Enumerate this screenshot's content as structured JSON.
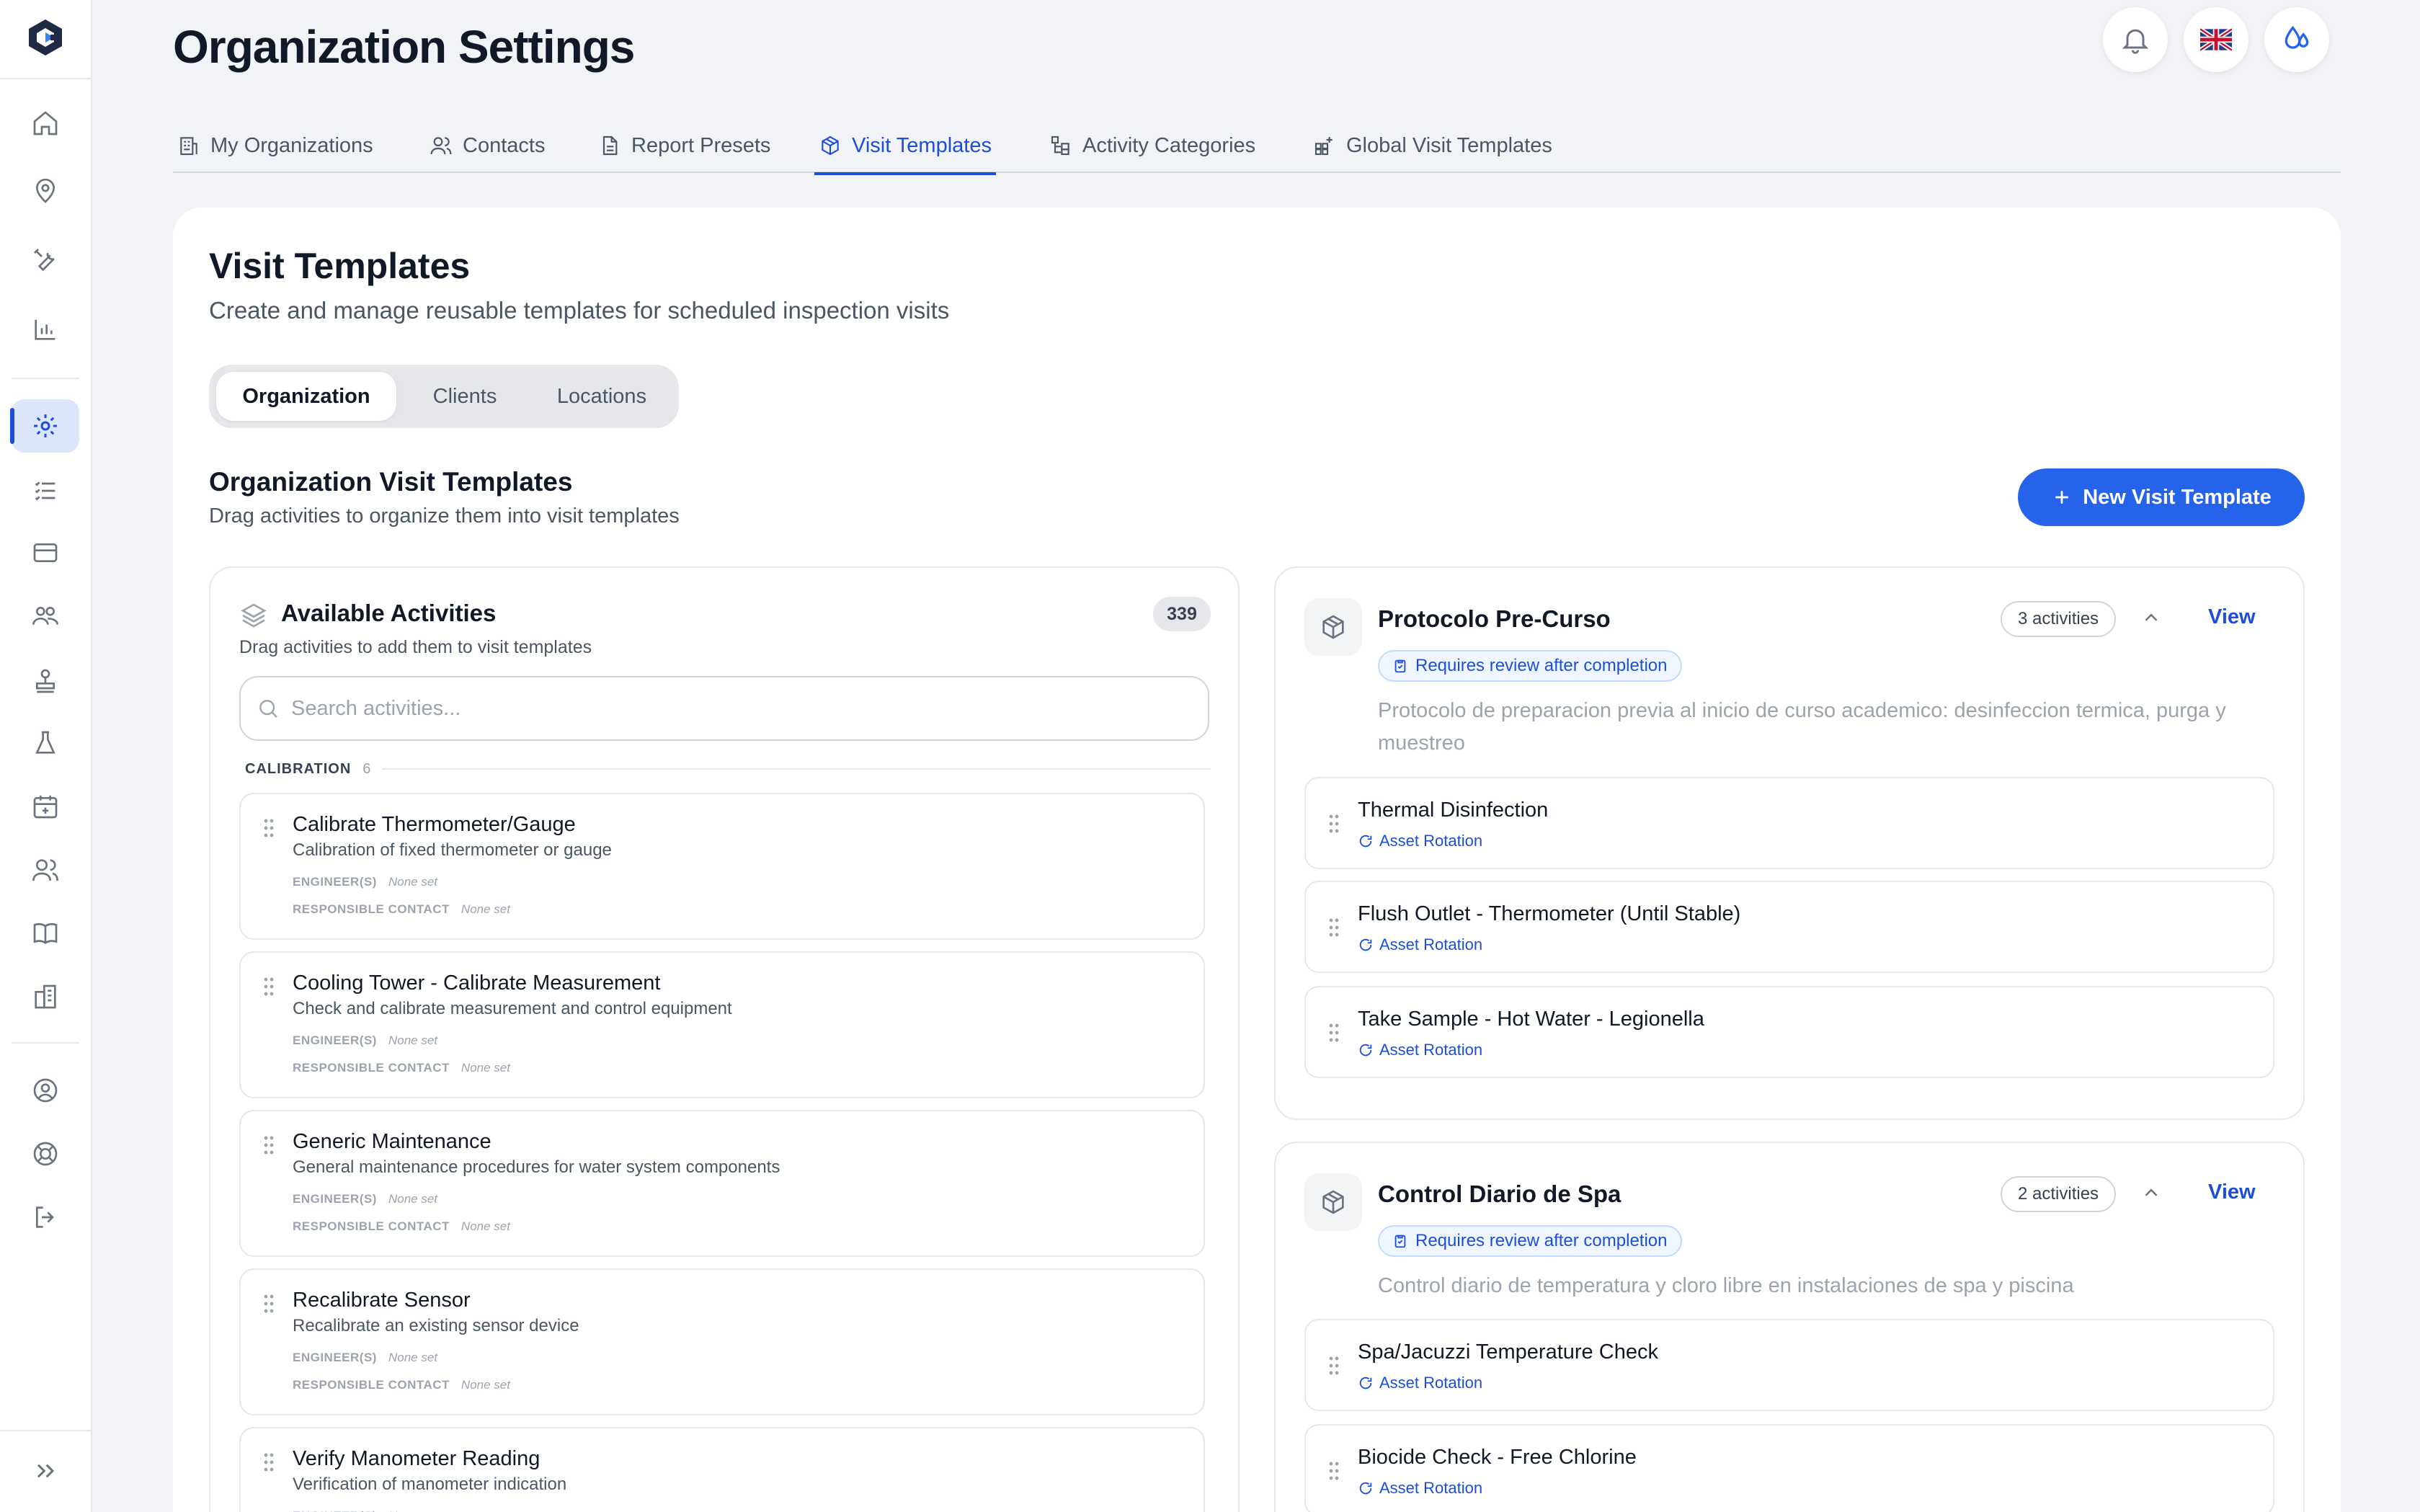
{
  "page": {
    "title": "Organization Settings"
  },
  "header": {
    "notifications_icon": "bell-icon",
    "language_icon": "uk-flag-icon",
    "theme_icon": "droplet-icon"
  },
  "tabs": [
    {
      "label": "My Organizations",
      "icon": "building-icon"
    },
    {
      "label": "Contacts",
      "icon": "users-icon"
    },
    {
      "label": "Report Presets",
      "icon": "document-icon"
    },
    {
      "label": "Visit Templates",
      "icon": "package-icon",
      "active": true
    },
    {
      "label": "Activity Categories",
      "icon": "category-tree-icon"
    },
    {
      "label": "Global Visit Templates",
      "icon": "grid-plus-icon"
    }
  ],
  "section": {
    "title": "Visit Templates",
    "subtitle": "Create and manage reusable templates for scheduled inspection visits"
  },
  "segments": [
    {
      "label": "Organization",
      "active": true
    },
    {
      "label": "Clients"
    },
    {
      "label": "Locations"
    }
  ],
  "org_templates": {
    "title": "Organization Visit Templates",
    "subtitle": "Drag activities to organize them into visit templates",
    "new_button": "New Visit Template"
  },
  "available": {
    "title": "Available Activities",
    "count": "339",
    "subtitle": "Drag activities to add them to visit templates",
    "search_placeholder": "Search activities...",
    "group": {
      "name": "CALIBRATION",
      "count": "6"
    },
    "engineer_label": "ENGINEER(S)",
    "contact_label": "RESPONSIBLE CONTACT",
    "none_set": "None set",
    "items": [
      {
        "name": "Calibrate Thermometer/Gauge",
        "description": "Calibration of fixed thermometer or gauge"
      },
      {
        "name": "Cooling Tower - Calibrate Measurement",
        "description": "Check and calibrate measurement and control equipment"
      },
      {
        "name": "Generic Maintenance",
        "description": "General maintenance procedures for water system components"
      },
      {
        "name": "Recalibrate Sensor",
        "description": "Recalibrate an existing sensor device"
      },
      {
        "name": "Verify Manometer Reading",
        "description": "Verification of manometer indication"
      }
    ]
  },
  "templates": [
    {
      "name": "Protocolo Pre-Curso",
      "count": "3 activities",
      "view": "View",
      "badge": "Requires review after completion",
      "description": "Protocolo de preparacion previa al inicio de curso academico: desinfeccion termica, purga y muestreo",
      "activities": [
        {
          "name": "Thermal Disinfection",
          "tag": "Asset Rotation"
        },
        {
          "name": "Flush Outlet - Thermometer (Until Stable)",
          "tag": "Asset Rotation"
        },
        {
          "name": "Take Sample - Hot Water - Legionella",
          "tag": "Asset Rotation"
        }
      ]
    },
    {
      "name": "Control Diario de Spa",
      "count": "2 activities",
      "view": "View",
      "badge": "Requires review after completion",
      "description": "Control diario de temperatura y cloro libre en instalaciones de spa y piscina",
      "activities": [
        {
          "name": "Spa/Jacuzzi Temperature Check",
          "tag": "Asset Rotation"
        },
        {
          "name": "Biocide Check - Free Chlorine",
          "tag": "Asset Rotation"
        }
      ]
    }
  ],
  "colors": {
    "accent": "#2563eb",
    "accent_dark": "#1d4ed8",
    "background": "#f1f3f6"
  }
}
